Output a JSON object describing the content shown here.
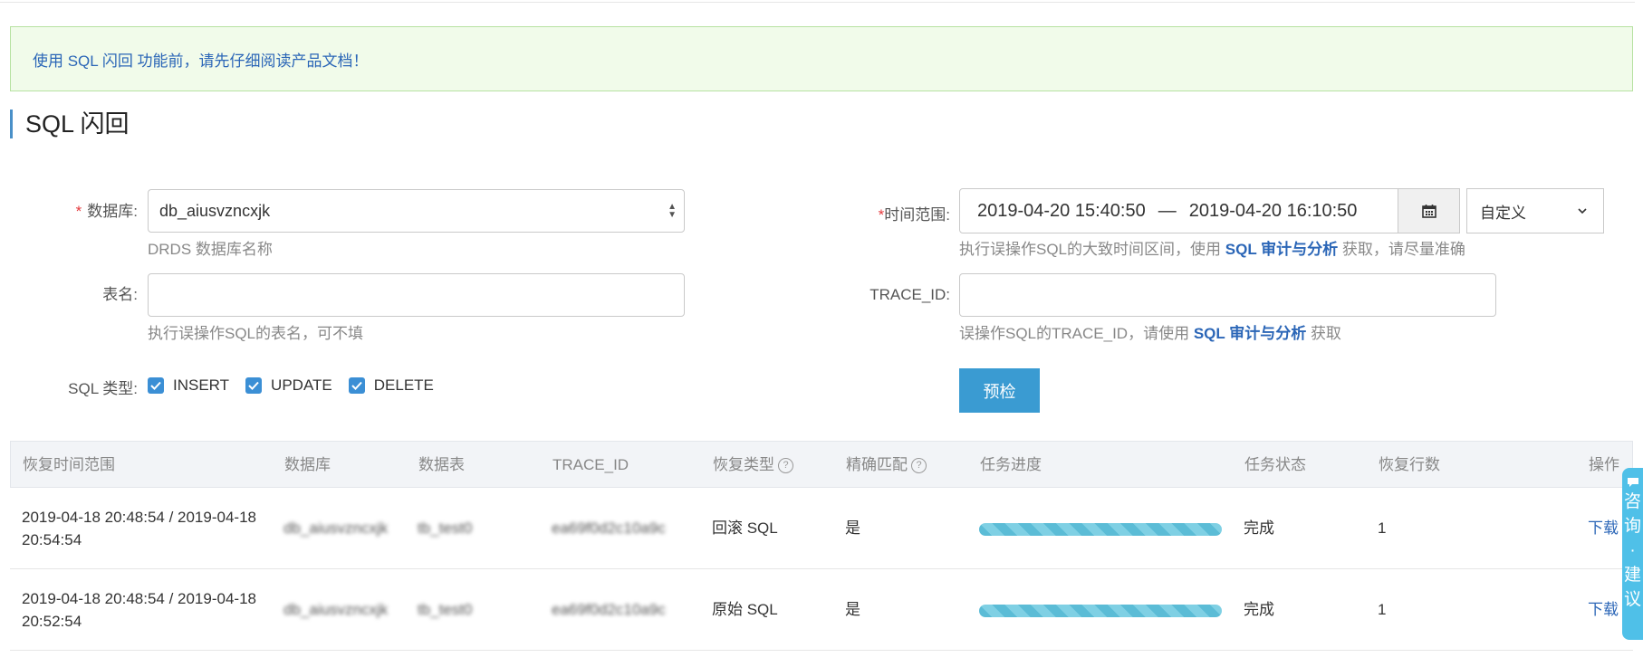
{
  "notice": "使用 SQL 闪回 功能前，请先仔细阅读产品文档！",
  "page_title": "SQL 闪回",
  "form": {
    "database": {
      "label": "数据库:",
      "value": "db_aiusvzncxjk",
      "hint": "DRDS 数据库名称"
    },
    "table_name": {
      "label": "表名:",
      "value": "",
      "hint": "执行误操作SQL的表名，可不填"
    },
    "sql_type": {
      "label": "SQL 类型:",
      "options": [
        "INSERT",
        "UPDATE",
        "DELETE"
      ]
    },
    "time_range": {
      "label": "时间范围:",
      "start": "2019-04-20 15:40:50",
      "separator": "—",
      "end": "2019-04-20 16:10:50",
      "preset": "自定义",
      "hint_prefix": "执行误操作SQL的大致时间区间，使用",
      "hint_link": "SQL 审计与分析",
      "hint_suffix": "获取，请尽量准确"
    },
    "trace_id": {
      "label": "TRACE_ID:",
      "value": "",
      "hint_prefix": "误操作SQL的TRACE_ID，请使用",
      "hint_link": "SQL 审计与分析",
      "hint_suffix": "获取"
    },
    "precheck_button": "预检"
  },
  "table": {
    "headers": [
      "恢复时间范围",
      "数据库",
      "数据表",
      "TRACE_ID",
      "恢复类型",
      "精确匹配",
      "任务进度",
      "任务状态",
      "恢复行数",
      "操作"
    ],
    "help_icon": "?",
    "rows": [
      {
        "time_range": "2019-04-18 20:48:54 / 2019-04-18 20:54:54",
        "database": "db_aiusvzncxjk",
        "table": "tb_test0",
        "trace_id": "ea69f0d2c10a9c",
        "recovery_type": "回滚 SQL",
        "exact_match": "是",
        "progress": 1.0,
        "status": "完成",
        "rows_restored": "1",
        "action": "下载"
      },
      {
        "time_range": "2019-04-18 20:48:54 / 2019-04-18 20:52:54",
        "database": "db_aiusvzncxjk",
        "table": "tb_test0",
        "trace_id": "ea69f0d2c10a9c",
        "recovery_type": "原始 SQL",
        "exact_match": "是",
        "progress": 1.0,
        "status": "完成",
        "rows_restored": "1",
        "action": "下载"
      }
    ]
  },
  "feedback_tab": {
    "chars": [
      "咨",
      "询",
      "·",
      "建",
      "议"
    ]
  },
  "colors": {
    "accent": "#3a9bd2",
    "link": "#2b66b7",
    "notice_bg": "#f1fbea",
    "progress": "#5bbcd6"
  }
}
